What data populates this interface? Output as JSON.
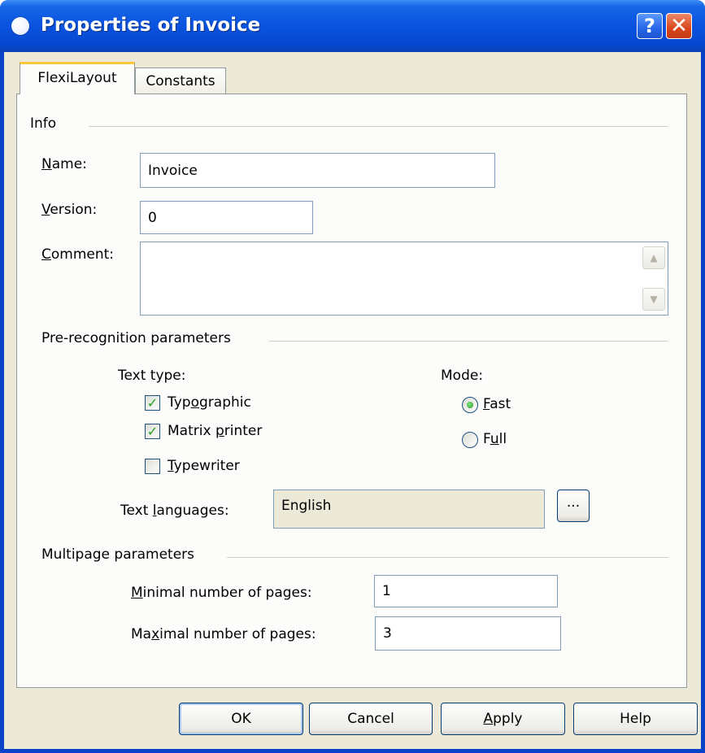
{
  "window": {
    "title": "Properties of Invoice",
    "help_glyph": "?",
    "close_glyph": "✕",
    "title_color": "#0a54e0"
  },
  "tabs": [
    {
      "label": "FlexiLayout",
      "active": true
    },
    {
      "label": "Constants",
      "active": false
    }
  ],
  "info": {
    "section_label": "Info",
    "name": {
      "label_ul": "N",
      "label_rest": "ame:",
      "value": "Invoice"
    },
    "version": {
      "label_ul": "V",
      "label_rest": "ersion:",
      "value": "0"
    },
    "comment": {
      "label_ul": "C",
      "label_rest": "omment:",
      "value": ""
    }
  },
  "prerecognition": {
    "section_label": "Pre-recognition parameters",
    "text_type_label": "Text type:",
    "checkboxes": [
      {
        "pre": "Typ",
        "ul": "o",
        "post": "graphic",
        "checked": true
      },
      {
        "pre": "Matrix ",
        "ul": "p",
        "post": "rinter",
        "checked": true
      },
      {
        "pre": "",
        "ul": "T",
        "post": "ypewriter",
        "checked": false
      }
    ],
    "mode_label": "Mode:",
    "radios": [
      {
        "pre": "",
        "ul": "F",
        "post": "ast",
        "selected": true
      },
      {
        "pre": "F",
        "ul": "u",
        "post": "ll",
        "selected": false
      }
    ],
    "languages": {
      "pre": "Text ",
      "ul": "l",
      "post": "anguages:",
      "value": "English",
      "browse_label": "..."
    }
  },
  "multipage": {
    "section_label": "Multipage parameters",
    "minimal": {
      "pre": "",
      "ul": "M",
      "post": "inimal number of pages:",
      "value": "1"
    },
    "maximal": {
      "pre": "Ma",
      "ul": "x",
      "post": "imal number of pages:",
      "value": "3"
    }
  },
  "buttons": {
    "ok": "OK",
    "cancel": "Cancel",
    "apply_ul": "A",
    "apply_rest": "pply",
    "help": "Help"
  }
}
